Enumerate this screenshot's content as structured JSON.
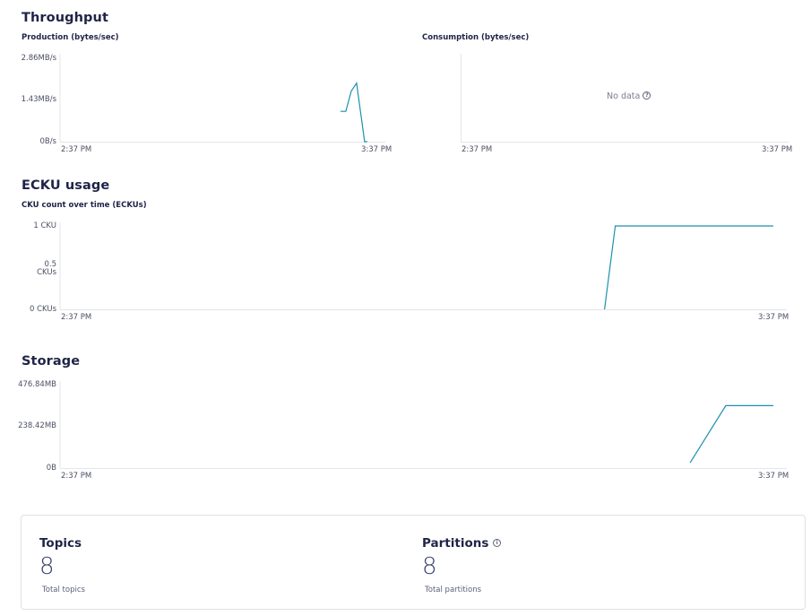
{
  "throughput": {
    "title": "Throughput",
    "production": {
      "title": "Production (bytes/sec)",
      "y_ticks": [
        "2.86MB/s",
        "1.43MB/s",
        "0B/s"
      ],
      "x_ticks": [
        "2:37 PM",
        "3:37 PM"
      ]
    },
    "consumption": {
      "title": "Consumption (bytes/sec)",
      "no_data": "No data",
      "x_ticks": [
        "2:37 PM",
        "3:37 PM"
      ]
    }
  },
  "ecku": {
    "title": "ECKU usage",
    "chart": {
      "title": "CKU count over time (ECKUs)",
      "y_ticks": [
        "1 CKU",
        "0.5\nCKUs",
        "0 CKUs"
      ],
      "x_ticks": [
        "2:37 PM",
        "3:37 PM"
      ]
    }
  },
  "storage": {
    "title": "Storage",
    "y_ticks": [
      "476.84MB",
      "238.42MB",
      "0B"
    ],
    "x_ticks": [
      "2:37 PM",
      "3:37 PM"
    ]
  },
  "summary": {
    "topics": {
      "title": "Topics",
      "value": "8",
      "caption": "Total topics"
    },
    "partitions": {
      "title": "Partitions",
      "value": "8",
      "caption": "Total partitions"
    }
  },
  "colors": {
    "line": "#1e8fb0",
    "axis": "#e3e5ea"
  },
  "chart_data": [
    {
      "type": "line",
      "title": "Production (bytes/sec)",
      "ylabel": "bytes/sec",
      "ylim": [
        0,
        2.86
      ],
      "y_unit": "MB/s",
      "xlim": [
        0,
        60
      ],
      "x_unit": "minutes after 2:37 PM",
      "series": [
        {
          "x": [
            52.0,
            53.0,
            54.0,
            55.0,
            56.5,
            57.0
          ],
          "values": [
            1.05,
            1.05,
            1.75,
            2.03,
            0.0,
            0.0
          ]
        }
      ]
    },
    {
      "type": "line",
      "title": "Consumption (bytes/sec)",
      "series": []
    },
    {
      "type": "line",
      "title": "CKU count over time (ECKUs)",
      "ylim": [
        0,
        1
      ],
      "xlim": [
        0,
        60
      ],
      "series": [
        {
          "x": [
            45.8,
            46.7,
            60.0
          ],
          "values": [
            0,
            1,
            1
          ]
        }
      ]
    },
    {
      "type": "line",
      "title": "Storage",
      "ylim": [
        0,
        476.84
      ],
      "y_unit": "MB",
      "xlim": [
        0,
        60
      ],
      "series": [
        {
          "x": [
            53.0,
            56.0,
            60.0
          ],
          "values": [
            30,
            357,
            357
          ]
        }
      ]
    }
  ]
}
